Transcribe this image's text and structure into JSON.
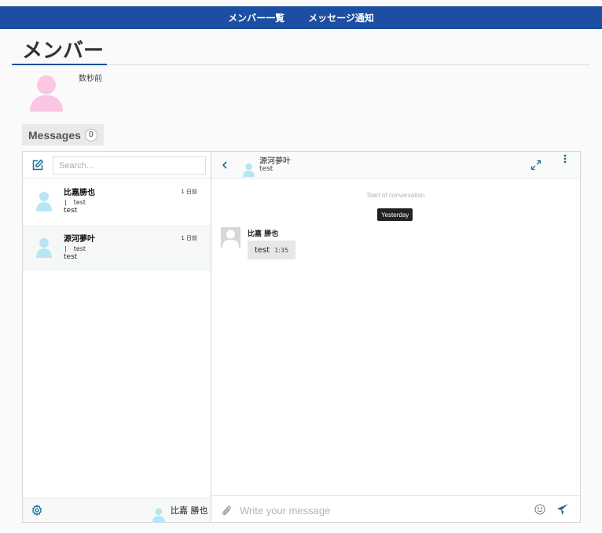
{
  "nav": {
    "links": [
      "メンバー一覧",
      "メッセージ通知"
    ],
    "bg_color": "#1c4fa3"
  },
  "page": {
    "title": "メンバー"
  },
  "profile": {
    "avatar_icon": "user-avatar-pink-icon",
    "time_ago": "数秒前"
  },
  "messages_tab": {
    "label": "Messages",
    "count": "0"
  },
  "sidebar": {
    "search_placeholder": "Search...",
    "conversations": [
      {
        "name": "比嘉勝也",
        "time": "1 日前",
        "preview_marker": "|",
        "preview_line": "test",
        "preview_text": "test",
        "active": false
      },
      {
        "name": "源河夢叶",
        "time": "1 日前",
        "preview_marker": "|",
        "preview_line": "test",
        "preview_text": "test",
        "active": true
      }
    ],
    "current_user_name": "比嘉 勝也"
  },
  "chat": {
    "header_name": "源河夢叶",
    "header_status": "test",
    "start_label": "Start of conversation",
    "date_label": "Yesterday",
    "messages": [
      {
        "author": "比嘉 勝也",
        "text": "test",
        "time": "1:35"
      }
    ],
    "input_placeholder": "Write your message"
  },
  "colors": {
    "accent": "#1c4fa3",
    "icon_teal": "#1c6f8e",
    "avatar_pink": "#fbc6e4",
    "avatar_cyan": "#b6e6f4"
  }
}
